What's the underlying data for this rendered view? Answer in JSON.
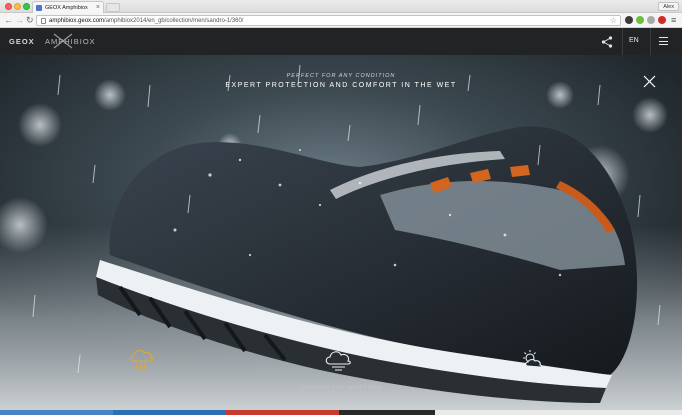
{
  "browser": {
    "tab_title": "GEOX Amphibiox",
    "tab_close": "×",
    "profile": "Alex",
    "url_host": "amphibiox.geox.com",
    "url_path": "/amphibiox2014/en_gb/collection/men/sandro-1/360/",
    "icons": [
      "back-arrow-icon",
      "forward-arrow-icon",
      "reload-icon",
      "bookmark-star-icon",
      "menu-icon"
    ]
  },
  "header": {
    "brand": "GEOX",
    "sub_brand": "AMPHIBIOX",
    "language": "EN"
  },
  "hero": {
    "subtitle": "PERFECT FOR ANY CONDITION",
    "title": "EXPERT PROTECTION AND COMFORT IN THE WET",
    "caption": "CHANGE THE WEATHER",
    "active_weather": "rain",
    "accent_color": "#e0a63a"
  },
  "footer_colors": [
    "#4a84c5",
    "#2f6fb3",
    "#c8392e",
    "#2a2a2a",
    "#e9e9e9"
  ]
}
